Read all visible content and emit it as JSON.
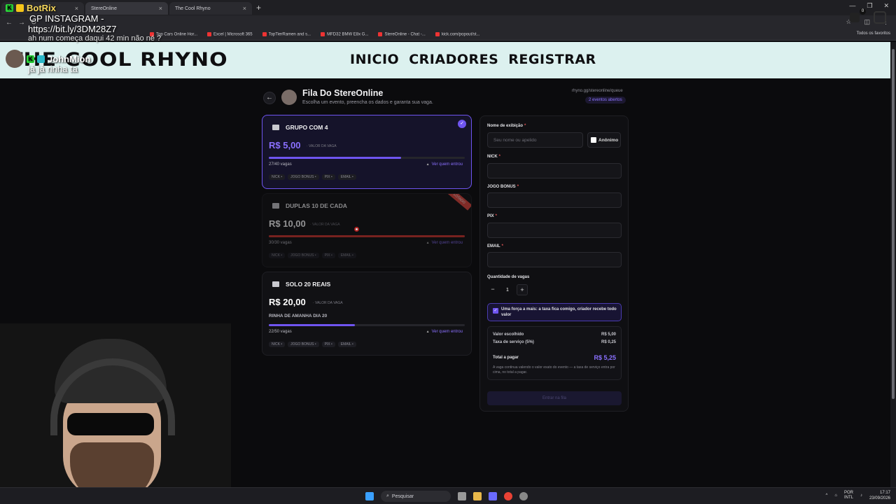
{
  "browser": {
    "tabs": [
      {
        "title": "",
        "active": false
      },
      {
        "title": "StereOnline",
        "active": true
      },
      {
        "title": "The Cool Rhyno",
        "active": false
      }
    ],
    "bookmarks": [
      "Top Cars Online Hor...",
      "Excel | Microsoft 365",
      "TopTierRamen and s...",
      "MFD32 BMW E8x G...",
      "StereOnline - Chat -...",
      "kick.com/popout/st..."
    ],
    "favorites_label": "Todos os favoritos"
  },
  "chat": {
    "line1_user": "BotRix",
    "line1_msg": "GP INSTAGRAM -",
    "line1_link": "https://bit.ly/3DM28Z7",
    "line2_msg": "ah num começa daqui 42 min não né ?",
    "line3_user": "JohnMion",
    "line3_msg": "já já rinha ta"
  },
  "site": {
    "logo": "THE COOL RHYNO",
    "nav": [
      "INICIO",
      "CRIADORES",
      "REGISTRAR"
    ],
    "cart_count": "0"
  },
  "page": {
    "title": "Fila Do StereOnline",
    "subtitle": "Escolha um evento, preencha os dados e garanta sua vaga.",
    "url": "rhyno.gg/stereonline/queue",
    "events_open": "2 eventos abertos"
  },
  "events": [
    {
      "name": "GRUPO COM 4",
      "price": "R$ 5,00",
      "price_label": "· VALOR DA VAGA",
      "slots": "27/40 vagas",
      "fill": 0.675,
      "who": "Ver quem entrou",
      "tags": [
        "NICK •",
        "JOGO BONUS •",
        "PIX •",
        "EMAIL •"
      ],
      "desc": ""
    },
    {
      "name": "DUPLAS 10 DE CADA",
      "price": "R$ 10,00",
      "price_label": "· VALOR DA VAGA",
      "slots": "30/30 vagas",
      "fill": 1.0,
      "who": "Ver quem entrou",
      "tags": [
        "NICK •",
        "JOGO BONUS •",
        "PIX •",
        "EMAIL •"
      ],
      "desc": "",
      "ribbon": "LOTADO"
    },
    {
      "name": "SOLO 20 REAIS",
      "price": "R$ 20,00",
      "price_label": "· VALOR DA VAGA",
      "slots": "22/50 vagas",
      "fill": 0.44,
      "who": "Ver quem entrou",
      "tags": [
        "NICK •",
        "JOGO BONUS •",
        "PIX •",
        "EMAIL •"
      ],
      "desc": "RINHA DE AMANHA DIA 20"
    }
  ],
  "form": {
    "display_name_label": "Nome de exibição",
    "display_name_placeholder": "Seu nome ou apelido",
    "anon_label": "Anônimo",
    "nick_label": "NICK",
    "jogo_label": "JOGO BONUS",
    "pix_label": "PIX",
    "email_label": "EMAIL",
    "qty_label": "Quantidade de vagas",
    "qty_minus": "−",
    "qty_value": "1",
    "qty_plus": "+",
    "consent_text": "Uma força a mais: a taxa fica comigo, criador recebe todo valor",
    "summary_chosen_label": "Valor escolhido",
    "summary_chosen_value": "R$ 5,00",
    "summary_fee_label": "Taxa de serviço (5%)",
    "summary_fee_value": "R$ 0,25",
    "summary_total_label": "Total a pagar",
    "summary_total_value": "R$ 5,25",
    "summary_note": "A vaga continua valendo o valor exato do evento — a taxa de serviço entra por cima, no total a pagar.",
    "submit_label": "Entrar na fila"
  },
  "taskbar": {
    "search": "Pesquisar",
    "lang": "POR\nINTL",
    "time": "17:17",
    "date": "23/09/2026"
  }
}
